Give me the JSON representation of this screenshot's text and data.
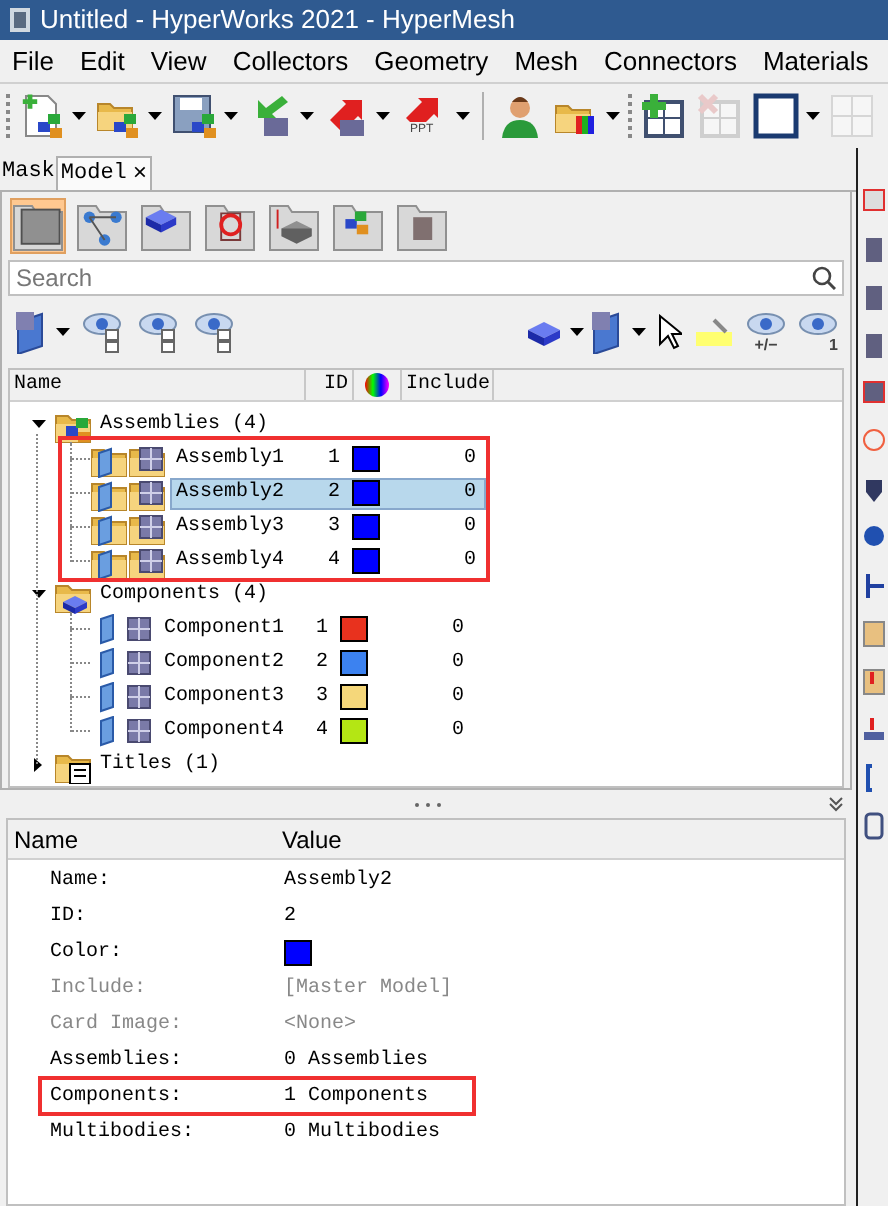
{
  "window": {
    "title": "Untitled - HyperWorks 2021 - HyperMesh"
  },
  "menu": [
    "File",
    "Edit",
    "View",
    "Collectors",
    "Geometry",
    "Mesh",
    "Connectors",
    "Materials"
  ],
  "toolbar": {
    "ppt_label": "PPT"
  },
  "tabs": [
    {
      "label": "Mask",
      "selected": false
    },
    {
      "label": "Model",
      "selected": true,
      "close": "×"
    }
  ],
  "browser_views": [
    {
      "selected": true
    },
    {
      "selected": false
    },
    {
      "selected": false
    },
    {
      "selected": false
    },
    {
      "selected": false
    },
    {
      "selected": false
    },
    {
      "selected": false
    }
  ],
  "search": {
    "placeholder": "Search"
  },
  "filter_bar": {
    "plus_minus_label": "+/−",
    "one_label": "1"
  },
  "tree": {
    "columns": [
      "Name",
      "ID",
      "Include"
    ],
    "items": [
      {
        "kind": "assembly-folder",
        "label": "Assemblies (4)",
        "expanded": true,
        "highlighted": true,
        "children": [
          {
            "label": "Assembly1",
            "id": "1",
            "color": "#0000ff",
            "include": "0",
            "selected": false
          },
          {
            "label": "Assembly2",
            "id": "2",
            "color": "#0000ff",
            "include": "0",
            "selected": true
          },
          {
            "label": "Assembly3",
            "id": "3",
            "color": "#0000ff",
            "include": "0",
            "selected": false
          },
          {
            "label": "Assembly4",
            "id": "4",
            "color": "#0000ff",
            "include": "0",
            "selected": false
          }
        ]
      },
      {
        "kind": "component-folder",
        "label": "Components (4)",
        "expanded": true,
        "highlighted": false,
        "children": [
          {
            "label": "Component1",
            "id": "1",
            "color": "#e8321e",
            "include": "0",
            "selected": false
          },
          {
            "label": "Component2",
            "id": "2",
            "color": "#3c82f0",
            "include": "0",
            "selected": false
          },
          {
            "label": "Component3",
            "id": "3",
            "color": "#f5d77a",
            "include": "0",
            "selected": false
          },
          {
            "label": "Component4",
            "id": "4",
            "color": "#b4e614",
            "include": "0",
            "selected": false
          }
        ]
      },
      {
        "kind": "titles-folder",
        "label": "Titles (1)",
        "expanded": false,
        "highlighted": false
      }
    ]
  },
  "properties": {
    "columns": [
      "Name",
      "Value"
    ],
    "rows": [
      {
        "kind": "text",
        "label": "Name:",
        "value": "Assembly2",
        "disabled": false,
        "highlighted": false
      },
      {
        "kind": "text",
        "label": "ID:",
        "value": "2",
        "disabled": false,
        "highlighted": false
      },
      {
        "kind": "color",
        "label": "Color:",
        "color": "#0000ff",
        "disabled": false,
        "highlighted": false
      },
      {
        "kind": "text",
        "label": "Include:",
        "value": "[Master Model]",
        "disabled": true,
        "highlighted": false
      },
      {
        "kind": "text",
        "label": "Card Image:",
        "value": "<None>",
        "disabled": true,
        "highlighted": false
      },
      {
        "kind": "text",
        "label": "Assemblies:",
        "value": "0 Assemblies",
        "disabled": false,
        "highlighted": false
      },
      {
        "kind": "text",
        "label": "Components:",
        "value": "1 Components",
        "disabled": false,
        "highlighted": true
      },
      {
        "kind": "text",
        "label": "Multibodies:",
        "value": "0 Multibodies",
        "disabled": false,
        "highlighted": false
      }
    ]
  }
}
